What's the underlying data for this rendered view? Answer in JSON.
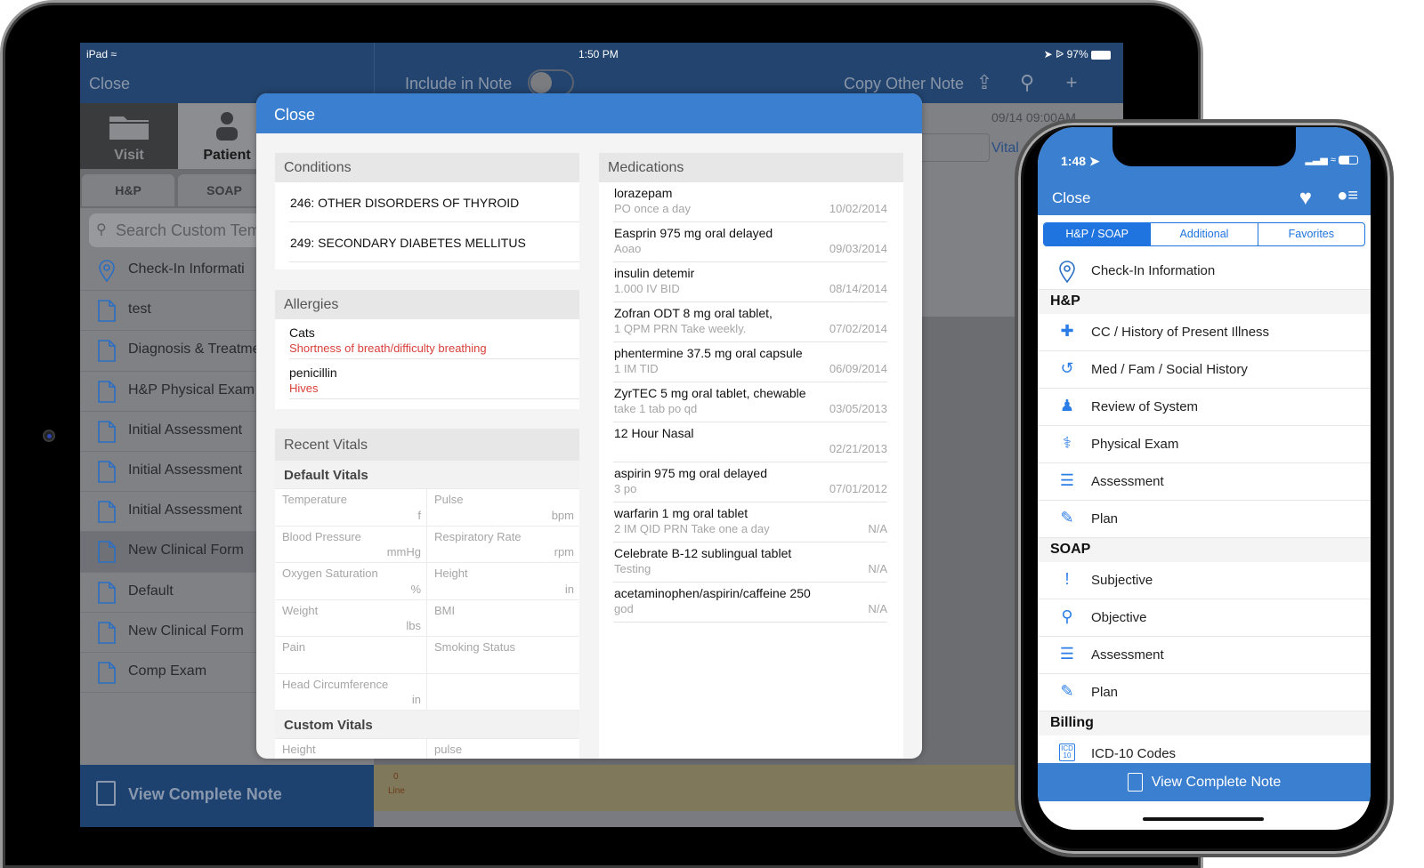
{
  "ipad": {
    "status": {
      "device": "iPad",
      "time": "1:50 PM",
      "battery": "97%"
    },
    "nav": {
      "close": "Close",
      "include_in_note": "Include in Note",
      "include_on": false,
      "copy_other_note": "Copy Other Note"
    },
    "segments": [
      {
        "label": "Visit",
        "icon": "folder-icon"
      },
      {
        "label": "Patient",
        "icon": "person-icon",
        "active": true
      }
    ],
    "subtabs": [
      "H&P",
      "SOAP"
    ],
    "search_placeholder": "Search Custom Tem",
    "list": [
      {
        "label": "Check-In Informati",
        "icon": "location-pin-icon"
      },
      {
        "label": "test",
        "icon": "document-icon"
      },
      {
        "label": "Diagnosis & Treatme",
        "icon": "document-icon"
      },
      {
        "label": "H&P Physical Exam",
        "icon": "document-icon"
      },
      {
        "label": "Initial Assessment",
        "icon": "document-icon"
      },
      {
        "label": "Initial Assessment",
        "icon": "document-icon"
      },
      {
        "label": "Initial Assessment",
        "icon": "document-icon"
      },
      {
        "label": "New Clinical Form",
        "icon": "document-icon",
        "selected": true
      },
      {
        "label": "Default",
        "icon": "document-icon"
      },
      {
        "label": "New Clinical Form",
        "icon": "document-icon"
      },
      {
        "label": "Comp Exam",
        "icon": "document-icon"
      }
    ],
    "view_complete_note": "View Complete Note",
    "line_count": "0",
    "line_label": "Line",
    "background": {
      "date": "09/14 09:00AM",
      "vitals_link": "Vital"
    }
  },
  "modal": {
    "close": "Close",
    "conditions": {
      "title": "Conditions",
      "items": [
        "246: OTHER DISORDERS OF THYROID",
        "249: SECONDARY DIABETES MELLITUS"
      ]
    },
    "allergies": {
      "title": "Allergies",
      "items": [
        {
          "allergen": "Cats",
          "reaction": "Shortness of breath/difficulty breathing"
        },
        {
          "allergen": "penicillin",
          "reaction": "Hives"
        }
      ]
    },
    "vitals": {
      "title": "Recent Vitals",
      "default_title": "Default Vitals",
      "default": [
        {
          "label": "Temperature",
          "unit": "f"
        },
        {
          "label": "Pulse",
          "unit": "bpm"
        },
        {
          "label": "Blood Pressure",
          "unit": "mmHg"
        },
        {
          "label": "Respiratory Rate",
          "unit": "rpm"
        },
        {
          "label": "Oxygen Saturation",
          "unit": "%"
        },
        {
          "label": "Height",
          "unit": "in"
        },
        {
          "label": "Weight",
          "unit": "lbs"
        },
        {
          "label": "BMI",
          "unit": ""
        },
        {
          "label": "Pain",
          "unit": ""
        },
        {
          "label": "Smoking Status",
          "unit": ""
        },
        {
          "label": "Head Circumference",
          "unit": "in"
        },
        {
          "label": "",
          "unit": ""
        }
      ],
      "custom_title": "Custom Vitals",
      "custom": [
        {
          "label": "Height",
          "unit": ""
        },
        {
          "label": "pulse",
          "unit": ""
        }
      ]
    },
    "medications": {
      "title": "Medications",
      "items": [
        {
          "name": "lorazepam",
          "sig": "PO once a day",
          "date": "10/02/2014"
        },
        {
          "name": "Easprin 975 mg oral delayed",
          "sig": "Aoao",
          "date": "09/03/2014"
        },
        {
          "name": "insulin detemir",
          "sig": "1.000  IV BID",
          "date": "08/14/2014"
        },
        {
          "name": "Zofran ODT 8 mg oral tablet,",
          "sig": "1   QPM PRN Take weekly.",
          "date": "07/02/2014"
        },
        {
          "name": "phentermine 37.5 mg oral capsule",
          "sig": "1  IM TID",
          "date": "06/09/2014"
        },
        {
          "name": "ZyrTEC 5 mg oral tablet, chewable",
          "sig": "take 1 tab po qd",
          "date": "03/05/2013"
        },
        {
          "name": "12 Hour Nasal",
          "sig": "",
          "date": "02/21/2013"
        },
        {
          "name": "aspirin 975 mg oral delayed",
          "sig": "3 po",
          "date": "07/01/2012"
        },
        {
          "name": "warfarin 1 mg oral tablet",
          "sig": "2  IM QID PRN Take one a day",
          "date": "N/A"
        },
        {
          "name": "Celebrate B-12 sublingual tablet",
          "sig": "Testing",
          "date": "N/A"
        },
        {
          "name": "acetaminophen/aspirin/caffeine 250",
          "sig": "god",
          "date": "N/A"
        }
      ]
    }
  },
  "iphone": {
    "time": "1:48",
    "close": "Close",
    "tabs": [
      {
        "label": "H&P / SOAP",
        "active": true
      },
      {
        "label": "Additional"
      },
      {
        "label": "Favorites"
      }
    ],
    "checkin": {
      "label": "Check-In Information",
      "icon": "location-pin-icon"
    },
    "sections": [
      {
        "title": "H&P",
        "items": [
          {
            "label": "CC / History of Present Illness",
            "icon": "medical-cross-icon"
          },
          {
            "label": "Med / Fam / Social History",
            "icon": "history-clock-icon"
          },
          {
            "label": "Review of System",
            "icon": "body-icon"
          },
          {
            "label": "Physical Exam",
            "icon": "stethoscope-icon"
          },
          {
            "label": "Assessment",
            "icon": "clipboard-icon"
          },
          {
            "label": "Plan",
            "icon": "pen-icon"
          }
        ]
      },
      {
        "title": "SOAP",
        "items": [
          {
            "label": "Subjective",
            "icon": "speech-exclamation-icon"
          },
          {
            "label": "Objective",
            "icon": "magnifier-icon"
          },
          {
            "label": "Assessment",
            "icon": "clipboard-icon"
          },
          {
            "label": "Plan",
            "icon": "pen-icon"
          }
        ]
      },
      {
        "title": "Billing",
        "items": [
          {
            "label": "ICD-10 Codes",
            "icon": "icd10-icon"
          }
        ]
      }
    ],
    "view_complete_note": "View Complete Note"
  },
  "colors": {
    "accent": "#3b7fd0",
    "nav_dark": "#22446e",
    "reaction_red": "#d9403a",
    "ios_blue": "#1f74e0"
  }
}
